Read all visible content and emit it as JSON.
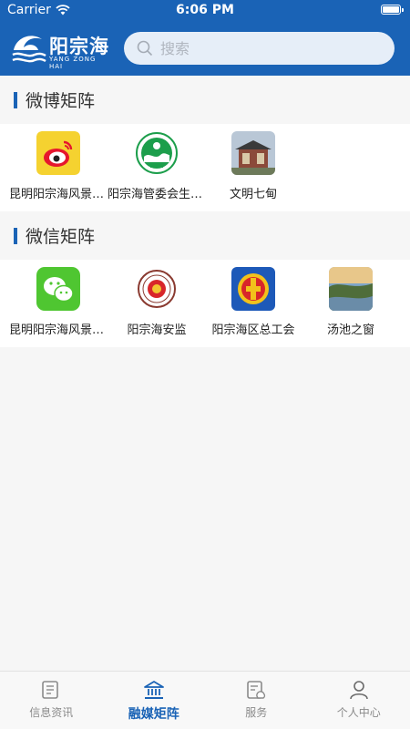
{
  "status": {
    "carrier": "Carrier",
    "time": "6:06 PM"
  },
  "header": {
    "logo_text": "阳宗海",
    "logo_sub": "YANG ZONG HAI",
    "search_placeholder": "搜索"
  },
  "sections": [
    {
      "title": "微博矩阵",
      "items": [
        {
          "label": "昆明阳宗海风景名胜区",
          "icon": "weibo-icon"
        },
        {
          "label": "阳宗海管委会生态环境局",
          "icon": "environment-emblem-icon"
        },
        {
          "label": "文明七甸",
          "icon": "building-photo"
        }
      ]
    },
    {
      "title": "微信矩阵",
      "items": [
        {
          "label": "昆明阳宗海风景名胜区",
          "icon": "wechat-icon"
        },
        {
          "label": "阳宗海安监",
          "icon": "safety-emblem-icon"
        },
        {
          "label": "阳宗海区总工会",
          "icon": "trade-union-emblem-icon"
        },
        {
          "label": "汤池之窗",
          "icon": "landscape-photo"
        }
      ]
    }
  ],
  "tabs": [
    {
      "label": "信息资讯",
      "icon": "news-icon",
      "active": false
    },
    {
      "label": "融媒矩阵",
      "icon": "bank-icon",
      "active": true
    },
    {
      "label": "服务",
      "icon": "service-icon",
      "active": false
    },
    {
      "label": "个人中心",
      "icon": "user-icon",
      "active": false
    }
  ],
  "colors": {
    "brand": "#1a63b6",
    "inactive": "#8a8a8a"
  }
}
